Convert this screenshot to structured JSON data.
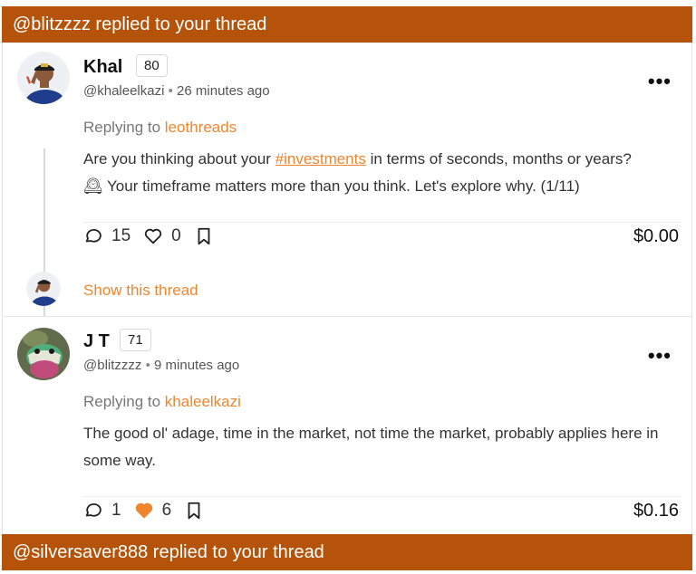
{
  "notifications": {
    "top_label": "@blitzzzz replied to your thread",
    "bottom_label": "@silversaver888 replied to your thread"
  },
  "posts": [
    {
      "display_name": "Khal",
      "reputation": "80",
      "handle": "@khaleelkazi",
      "separator": "•",
      "time": "26 minutes ago",
      "replying_prefix": "Replying to",
      "replying_to": "leothreads",
      "body_before": "Are you thinking about your",
      "hashtag": "#investments",
      "body_after": "in terms of seconds, months or years?",
      "body_line2": "Your timeframe matters more than you think. Let's explore why. (1/11)",
      "body_emoji": "🕰",
      "comments": "15",
      "likes": "0",
      "payout": "$0.00",
      "menu": "•••",
      "show_thread": "Show this thread"
    },
    {
      "display_name": "J T",
      "reputation": "71",
      "handle": "@blitzzzz",
      "separator": "•",
      "time": "9 minutes ago",
      "replying_prefix": "Replying to",
      "replying_to": "khaleelkazi",
      "body": "The good ol' adage, time in the market, not time the market, probably applies here in some way.",
      "comments": "1",
      "likes": "6",
      "liked": true,
      "payout": "$0.16",
      "menu": "•••"
    }
  ],
  "colors": {
    "banner": "#b5530b",
    "accent": "#f0852d"
  },
  "icons": [
    "comment-icon",
    "heart-icon",
    "bookmark-icon",
    "more-icon"
  ]
}
